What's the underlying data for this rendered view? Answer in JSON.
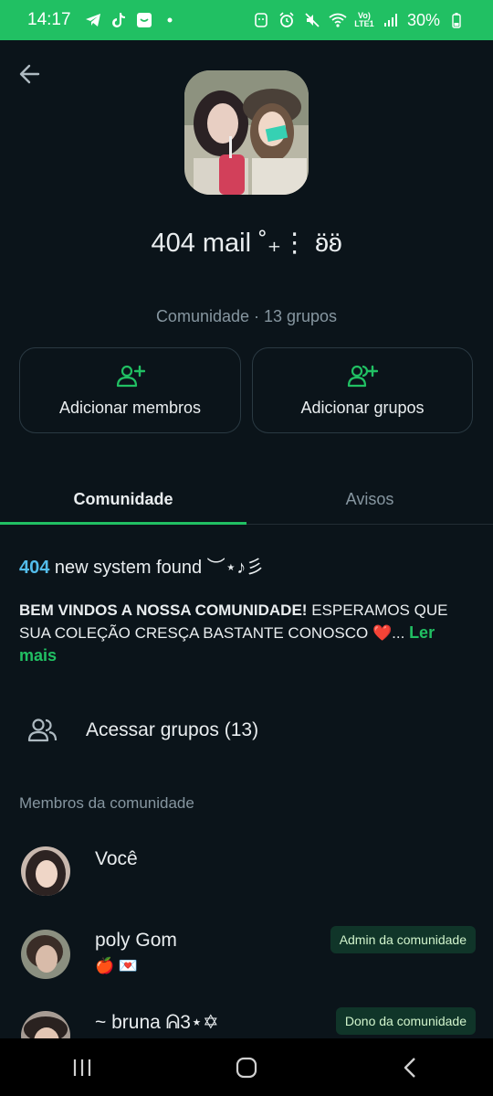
{
  "status_bar": {
    "time": "14:17",
    "battery": "30%",
    "left_icons": [
      "telegram-icon",
      "tiktok-icon",
      "message-icon",
      "dot-icon"
    ],
    "right_icons": [
      "android-icon",
      "alarm-icon",
      "mute-icon",
      "wifi-icon",
      "lte-icon",
      "signal-icon",
      "battery-icon"
    ]
  },
  "community": {
    "name": "404 mail ˚₊⋮ ʚ̈ʚ̈",
    "subtitle": "Comunidade · 13 grupos"
  },
  "actions": {
    "add_members": "Adicionar membros",
    "add_groups": "Adicionar grupos"
  },
  "tabs": {
    "community": "Comunidade",
    "announcements": "Avisos"
  },
  "description": {
    "number": "404",
    "headline": " new system found ︶⋆♪彡",
    "bold_part": "Bem vindos a nossa comunidade!",
    "rest": " esperamos que sua coleção cresça bastante conosco ❤️...",
    "read_more": "Ler mais"
  },
  "access_groups": {
    "label": "Acessar grupos (13)"
  },
  "members_section": {
    "label": "Membros da comunidade",
    "members": [
      {
        "name": "Você",
        "sub": "",
        "badge": ""
      },
      {
        "name": "poly Gom",
        "sub": "🍎 💌",
        "badge": "Admin da comunidade"
      },
      {
        "name": "~ bruna ᕱ3⋆✡",
        "sub": "",
        "badge": "Dono da comunidade"
      }
    ]
  },
  "colors": {
    "accent": "#21c063",
    "background": "#0b141a",
    "link_blue": "#53bdeb",
    "muted": "#8696a0"
  }
}
